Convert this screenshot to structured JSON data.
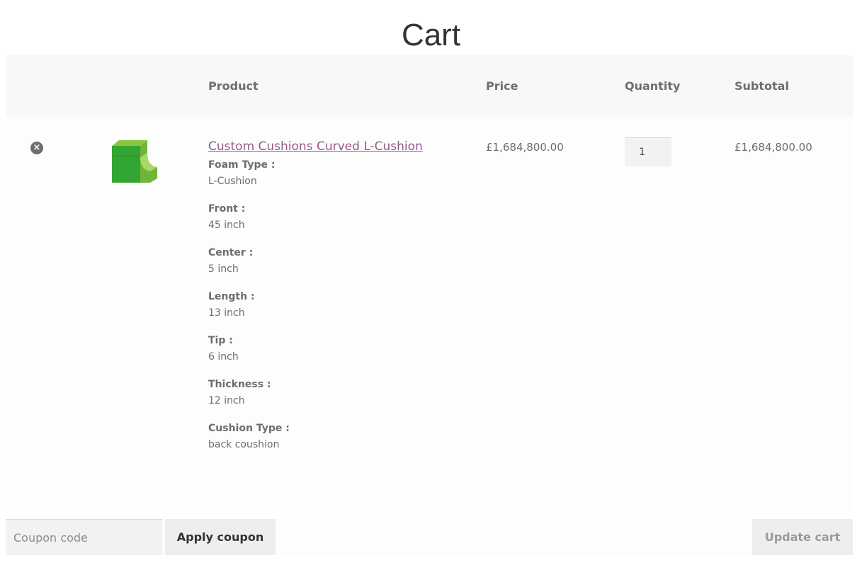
{
  "page": {
    "title": "Cart"
  },
  "table": {
    "headers": {
      "product": "Product",
      "price": "Price",
      "quantity": "Quantity",
      "subtotal": "Subtotal"
    }
  },
  "item": {
    "remove_icon": "×",
    "name": "Custom Cushions Curved L-Cushion",
    "thumbnail_icon": "green-l-cushion-icon",
    "meta": [
      {
        "key": "Foam Type :",
        "value": "L-Cushion"
      },
      {
        "key": "Front :",
        "value": "45 inch"
      },
      {
        "key": "Center :",
        "value": "5 inch"
      },
      {
        "key": "Length :",
        "value": "13 inch"
      },
      {
        "key": "Tip :",
        "value": "6 inch"
      },
      {
        "key": "Thickness :",
        "value": "12 inch"
      },
      {
        "key": "Cushion Type :",
        "value": "back coushion"
      }
    ],
    "price": "£1,684,800.00",
    "quantity": "1",
    "subtotal": "£1,684,800.00"
  },
  "actions": {
    "coupon_placeholder": "Coupon code",
    "apply_label": "Apply coupon",
    "update_label": "Update cart"
  },
  "colors": {
    "link": "#96588a",
    "header_bg": "#f8f8f8",
    "cushion_green": "#3aab3a",
    "cushion_light_green": "#8cc63f"
  }
}
